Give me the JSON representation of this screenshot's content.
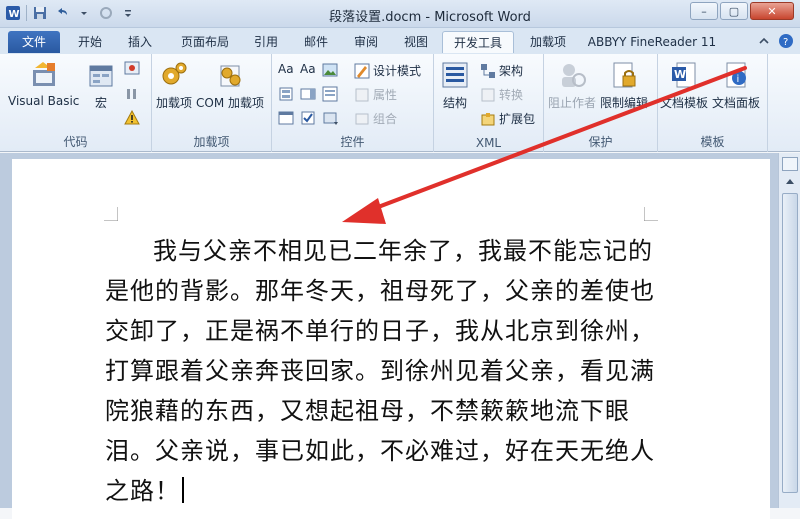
{
  "window": {
    "title": "段落设置.docm - Microsoft Word",
    "minimize": "–",
    "maximize": "▢",
    "close": "✕"
  },
  "tabs": [
    {
      "label": "文件"
    },
    {
      "label": "开始"
    },
    {
      "label": "插入"
    },
    {
      "label": "页面布局"
    },
    {
      "label": "引用"
    },
    {
      "label": "邮件"
    },
    {
      "label": "审阅"
    },
    {
      "label": "视图"
    },
    {
      "label": "开发工具"
    },
    {
      "label": "加载项"
    },
    {
      "label": "ABBYY FineReader 11"
    }
  ],
  "active_tab": "开发工具",
  "ribbon": {
    "code": {
      "label": "代码",
      "visual_basic": "Visual Basic",
      "macro": "宏"
    },
    "addins": {
      "label": "加载项",
      "addins": "加载项",
      "com_addins": "COM 加载项"
    },
    "controls": {
      "label": "控件",
      "design_mode": "设计模式",
      "properties": "属性",
      "group": "组合",
      "aa1": "Aa",
      "aa2": "Aa"
    },
    "xml": {
      "label": "XML",
      "structure": "结构",
      "schema": "架构",
      "transform": "转换",
      "expansion": "扩展包"
    },
    "protect": {
      "label": "保护",
      "block_authors": "阻止作者",
      "restrict_editing": "限制编辑"
    },
    "templates": {
      "label": "模板",
      "doc_template": "文档模板",
      "doc_panel": "文档面板"
    }
  },
  "document": {
    "lines": [
      "我与父亲不相见已二年余了，我最不能忘记",
      "的是他的背影。那年冬天，祖母死了，父亲的差",
      "使也交卸了，正是祸不单行的日子，我从北京到",
      "徐州，打算跟着父亲奔丧回家。到徐州见着父亲，",
      "看见满院狼藉的东西，又想起祖母，不禁簌簌地",
      "流下眼泪。父亲说，事已如此，不必难过，好在",
      "天无绝人之路！"
    ]
  },
  "colors": {
    "accent": "#2a59a1",
    "annotation_arrow": "#e0302b"
  }
}
